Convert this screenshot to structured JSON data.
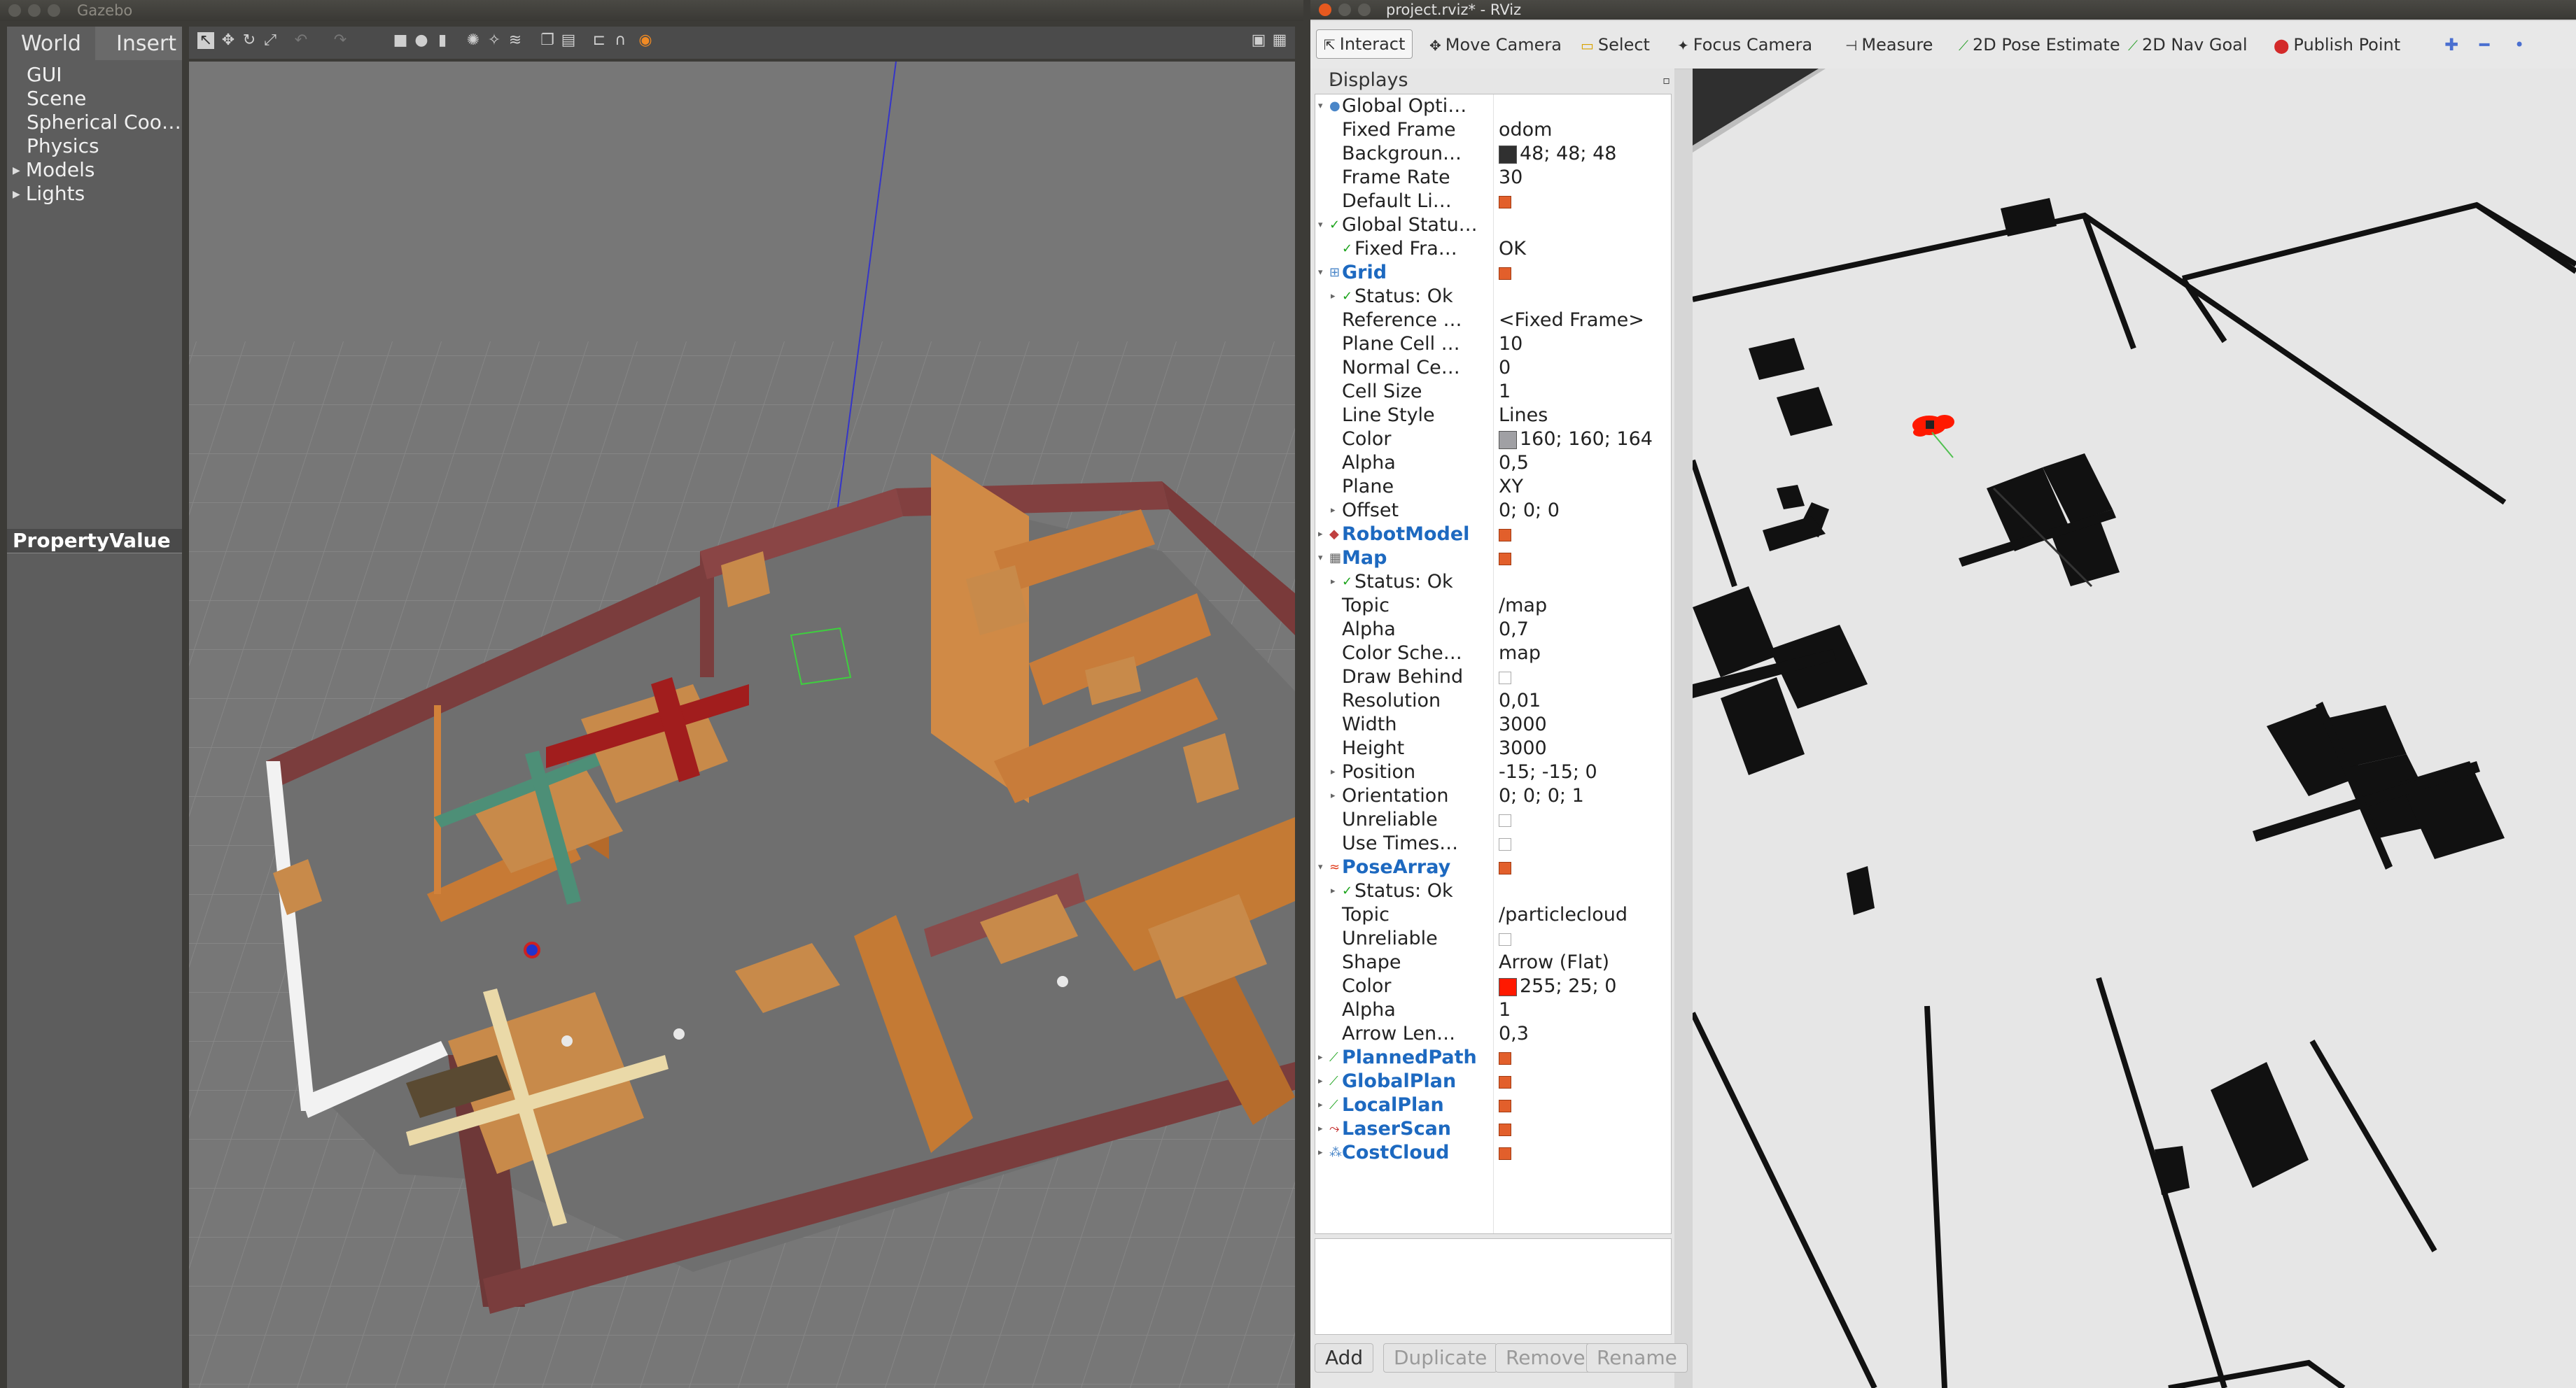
{
  "gazebo": {
    "title": "Gazebo",
    "tabs": [
      "World",
      "Insert"
    ],
    "tree": [
      "GUI",
      "Scene",
      "Spherical Coo…",
      "Physics",
      "Models",
      "Lights"
    ],
    "property_header": "PropertyValue"
  },
  "rviz": {
    "title": "project.rviz* - RViz",
    "toolbar": [
      {
        "label": "Interact",
        "icon": "cursor-icon"
      },
      {
        "label": "Move Camera",
        "icon": "move-camera-icon"
      },
      {
        "label": "Select",
        "icon": "select-icon"
      },
      {
        "label": "Focus Camera",
        "icon": "focus-camera-icon"
      },
      {
        "label": "Measure",
        "icon": "measure-icon"
      },
      {
        "label": "2D Pose Estimate",
        "icon": "pose-estimate-icon"
      },
      {
        "label": "2D Nav Goal",
        "icon": "nav-goal-icon"
      },
      {
        "label": "Publish Point",
        "icon": "publish-point-icon"
      }
    ],
    "displays_title": "Displays",
    "rows": [
      {
        "k": "Global Opti…",
        "v": "",
        "lvl": 0,
        "exp": "open",
        "style": "plain",
        "icon": "globe-icon"
      },
      {
        "k": "Fixed Frame",
        "v": "odom",
        "lvl": 1
      },
      {
        "k": "Backgroun…",
        "v": "48; 48; 48",
        "lvl": 1,
        "swatch": "#303030"
      },
      {
        "k": "Frame Rate",
        "v": "30",
        "lvl": 1
      },
      {
        "k": "Default Li…",
        "v": "",
        "lvl": 1,
        "check": "on"
      },
      {
        "k": "Global Statu…",
        "v": "",
        "lvl": 0,
        "exp": "open",
        "style": "plain",
        "icon": "check-icon"
      },
      {
        "k": "Fixed Fra…",
        "v": "OK",
        "lvl": 1,
        "icon": "check-icon"
      },
      {
        "k": "Grid",
        "v": "",
        "lvl": 0,
        "exp": "open",
        "style": "blue",
        "icon": "grid-icon",
        "check": "on"
      },
      {
        "k": "Status: Ok",
        "v": "",
        "lvl": 1,
        "exp": "closed",
        "icon": "check-icon"
      },
      {
        "k": "Reference …",
        "v": "<Fixed Frame>",
        "lvl": 1
      },
      {
        "k": "Plane Cell …",
        "v": "10",
        "lvl": 1
      },
      {
        "k": "Normal Ce…",
        "v": "0",
        "lvl": 1
      },
      {
        "k": "Cell Size",
        "v": "1",
        "lvl": 1
      },
      {
        "k": "Line Style",
        "v": "Lines",
        "lvl": 1
      },
      {
        "k": "Color",
        "v": "160; 160; 164",
        "lvl": 1,
        "swatch": "#a0a0a4"
      },
      {
        "k": "Alpha",
        "v": "0,5",
        "lvl": 1
      },
      {
        "k": "Plane",
        "v": "XY",
        "lvl": 1
      },
      {
        "k": "Offset",
        "v": "0; 0; 0",
        "lvl": 1,
        "exp": "closed"
      },
      {
        "k": "RobotModel",
        "v": "",
        "lvl": 0,
        "exp": "closed",
        "style": "blue",
        "icon": "robot-icon",
        "check": "on"
      },
      {
        "k": "Map",
        "v": "",
        "lvl": 0,
        "exp": "open",
        "style": "blue",
        "icon": "map-icon",
        "check": "on"
      },
      {
        "k": "Status: Ok",
        "v": "",
        "lvl": 1,
        "exp": "closed",
        "icon": "check-icon"
      },
      {
        "k": "Topic",
        "v": "/map",
        "lvl": 1
      },
      {
        "k": "Alpha",
        "v": "0,7",
        "lvl": 1
      },
      {
        "k": "Color Sche…",
        "v": "map",
        "lvl": 1
      },
      {
        "k": "Draw Behind",
        "v": "",
        "lvl": 1,
        "check": "off"
      },
      {
        "k": "Resolution",
        "v": "0,01",
        "lvl": 1
      },
      {
        "k": "Width",
        "v": "3000",
        "lvl": 1
      },
      {
        "k": "Height",
        "v": "3000",
        "lvl": 1
      },
      {
        "k": "Position",
        "v": "-15; -15; 0",
        "lvl": 1,
        "exp": "closed"
      },
      {
        "k": "Orientation",
        "v": "0; 0; 0; 1",
        "lvl": 1,
        "exp": "closed"
      },
      {
        "k": "Unreliable",
        "v": "",
        "lvl": 1,
        "check": "off"
      },
      {
        "k": "Use Times…",
        "v": "",
        "lvl": 1,
        "check": "off"
      },
      {
        "k": "PoseArray",
        "v": "",
        "lvl": 0,
        "exp": "open",
        "style": "blue",
        "icon": "pose-array-icon",
        "check": "on"
      },
      {
        "k": "Status: Ok",
        "v": "",
        "lvl": 1,
        "exp": "closed",
        "icon": "check-icon"
      },
      {
        "k": "Topic",
        "v": "/particlecloud",
        "lvl": 1
      },
      {
        "k": "Unreliable",
        "v": "",
        "lvl": 1,
        "check": "off"
      },
      {
        "k": "Shape",
        "v": "Arrow (Flat)",
        "lvl": 1
      },
      {
        "k": "Color",
        "v": "255; 25; 0",
        "lvl": 1,
        "swatch": "#ff1900"
      },
      {
        "k": "Alpha",
        "v": "1",
        "lvl": 1
      },
      {
        "k": "Arrow Len…",
        "v": "0,3",
        "lvl": 1
      },
      {
        "k": "PlannedPath",
        "v": "",
        "lvl": 0,
        "exp": "closed",
        "style": "blue",
        "icon": "path-icon",
        "check": "on"
      },
      {
        "k": "GlobalPlan",
        "v": "",
        "lvl": 0,
        "exp": "closed",
        "style": "blue",
        "icon": "path-icon",
        "check": "on"
      },
      {
        "k": "LocalPlan",
        "v": "",
        "lvl": 0,
        "exp": "closed",
        "style": "blue",
        "icon": "path-icon",
        "check": "on"
      },
      {
        "k": "LaserScan",
        "v": "",
        "lvl": 0,
        "exp": "closed",
        "style": "blue",
        "icon": "laser-icon",
        "check": "on"
      },
      {
        "k": "CostCloud",
        "v": "",
        "lvl": 0,
        "exp": "closed",
        "style": "blue",
        "icon": "cloud-icon",
        "check": "on"
      }
    ],
    "buttons": [
      {
        "label": "Add",
        "enabled": true
      },
      {
        "label": "Duplicate",
        "enabled": false
      },
      {
        "label": "Remove",
        "enabled": false
      },
      {
        "label": "Rename",
        "enabled": false
      }
    ]
  },
  "colors": {
    "accent_blue": "#1d69c0",
    "checkbox_orange": "#e25f2b",
    "particle_red": "#ff1900",
    "status_green": "#1aa31a"
  }
}
